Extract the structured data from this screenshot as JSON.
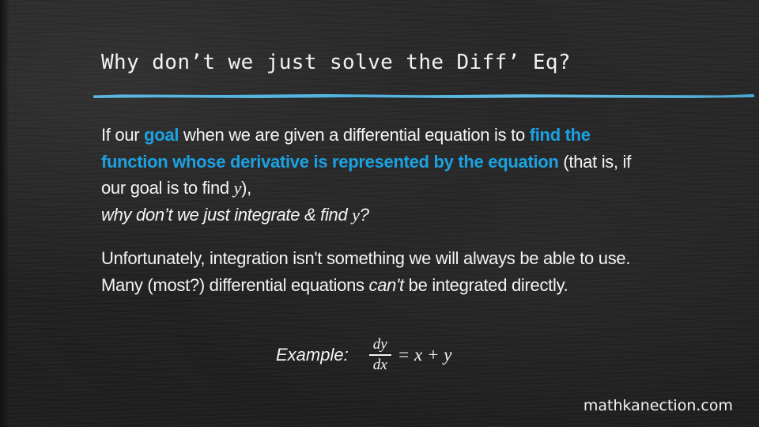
{
  "slide": {
    "title": "Why don’t we just solve the Diff’ Eq?",
    "paragraph1": {
      "t1": "If our ",
      "goal": "goal",
      "t2": " when we are given a differential equation is to ",
      "highlight": "find the function whose derivative is represented by the equation",
      "t3": " (that is, if our goal is to find ",
      "var_y": "y",
      "t4": "),",
      "question_a": "why don’t we just integrate & find ",
      "question_var": "y",
      "question_b": "?"
    },
    "stray_text": "dy/dx=x+y",
    "paragraph2": {
      "t1": "Unfortunately, integration isn't something we will always be able to use.  Many (most?) differential equations ",
      "emph": "can't",
      "t2": " be integrated directly."
    },
    "example": {
      "label": "Example:",
      "numerator": "dy",
      "denominator": "dx",
      "rhs": "= x + y"
    },
    "footer": "mathkanection.com"
  },
  "colors": {
    "background": "#242424",
    "accent": "#1ba1e2",
    "rule": "#5bb8e0",
    "text": "#f4f4f4"
  }
}
